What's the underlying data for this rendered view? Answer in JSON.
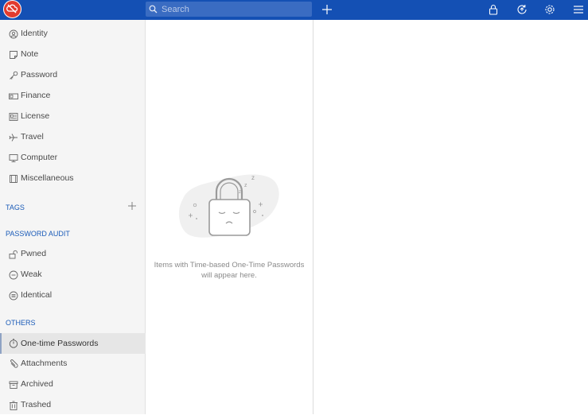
{
  "header": {
    "search_placeholder": "Search",
    "colors": {
      "bar": "#1450b4",
      "logo": "#e23b2e"
    },
    "icons": [
      "cloud-off-logo",
      "search-icon",
      "plus-icon",
      "lock-icon",
      "sync-icon",
      "gear-icon",
      "menu-icon"
    ]
  },
  "sidebar": {
    "categories": [
      {
        "label": "Identity",
        "icon": "identity-icon"
      },
      {
        "label": "Note",
        "icon": "note-icon"
      },
      {
        "label": "Password",
        "icon": "key-icon"
      },
      {
        "label": "Finance",
        "icon": "card-icon"
      },
      {
        "label": "License",
        "icon": "license-icon"
      },
      {
        "label": "Travel",
        "icon": "plane-icon"
      },
      {
        "label": "Computer",
        "icon": "monitor-icon"
      },
      {
        "label": "Miscellaneous",
        "icon": "misc-icon"
      }
    ],
    "tags_heading": "TAGS",
    "audit_heading": "PASSWORD AUDIT",
    "audit_items": [
      {
        "label": "Pwned",
        "icon": "unlock-icon"
      },
      {
        "label": "Weak",
        "icon": "weak-icon"
      },
      {
        "label": "Identical",
        "icon": "identical-icon"
      }
    ],
    "others_heading": "OTHERS",
    "others_items": [
      {
        "label": "One-time Passwords",
        "icon": "timer-icon",
        "active": true
      },
      {
        "label": "Attachments",
        "icon": "paperclip-icon"
      },
      {
        "label": "Archived",
        "icon": "archive-icon"
      },
      {
        "label": "Trashed",
        "icon": "trash-icon"
      }
    ]
  },
  "list": {
    "empty_line1": "Items with Time-based One-Time Passwords",
    "empty_line2": "will appear here."
  }
}
